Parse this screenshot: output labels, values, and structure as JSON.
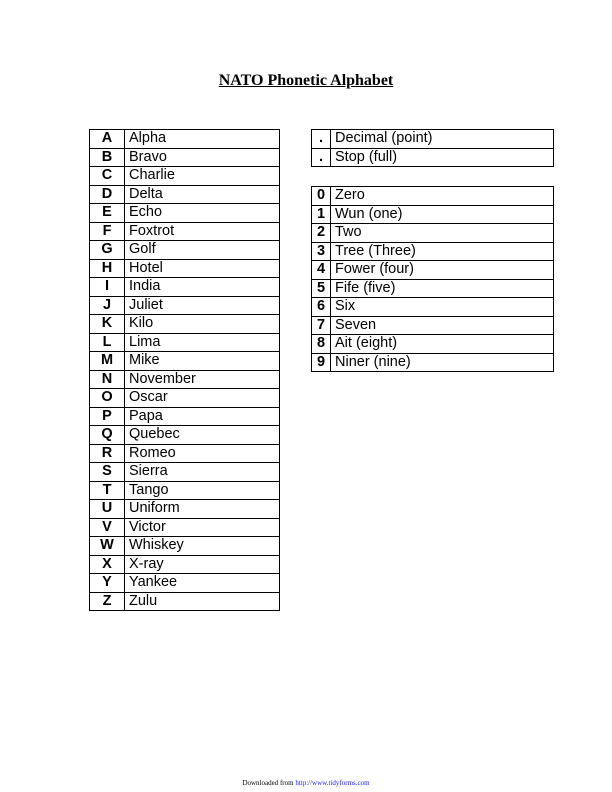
{
  "title": "NATO Phonetic Alphabet",
  "letters": [
    {
      "key": "A",
      "word": "Alpha"
    },
    {
      "key": "B",
      "word": "Bravo"
    },
    {
      "key": "C",
      "word": "Charlie"
    },
    {
      "key": "D",
      "word": "Delta"
    },
    {
      "key": "E",
      "word": "Echo"
    },
    {
      "key": "F",
      "word": "Foxtrot"
    },
    {
      "key": "G",
      "word": "Golf"
    },
    {
      "key": "H",
      "word": "Hotel"
    },
    {
      "key": "I",
      "word": "India"
    },
    {
      "key": "J",
      "word": "Juliet"
    },
    {
      "key": "K",
      "word": "Kilo"
    },
    {
      "key": "L",
      "word": "Lima"
    },
    {
      "key": "M",
      "word": "Mike"
    },
    {
      "key": "N",
      "word": "November"
    },
    {
      "key": "O",
      "word": "Oscar"
    },
    {
      "key": "P",
      "word": "Papa"
    },
    {
      "key": "Q",
      "word": "Quebec"
    },
    {
      "key": "R",
      "word": "Romeo"
    },
    {
      "key": "S",
      "word": "Sierra"
    },
    {
      "key": "T",
      "word": "Tango"
    },
    {
      "key": "U",
      "word": "Uniform"
    },
    {
      "key": "V",
      "word": "Victor"
    },
    {
      "key": "W",
      "word": "Whiskey"
    },
    {
      "key": "X",
      "word": "X-ray"
    },
    {
      "key": "Y",
      "word": "Yankee"
    },
    {
      "key": "Z",
      "word": "Zulu"
    }
  ],
  "symbols": [
    {
      "key": ".",
      "word": "Decimal (point)"
    },
    {
      "key": ".",
      "word": "Stop (full)"
    }
  ],
  "digits": [
    {
      "key": "0",
      "word": "Zero"
    },
    {
      "key": "1",
      "word": "Wun (one)"
    },
    {
      "key": "2",
      "word": "Two"
    },
    {
      "key": "3",
      "word": "Tree (Three)"
    },
    {
      "key": "4",
      "word": "Fower (four)"
    },
    {
      "key": "5",
      "word": "Fife (five)"
    },
    {
      "key": "6",
      "word": "Six"
    },
    {
      "key": "7",
      "word": "Seven"
    },
    {
      "key": "8",
      "word": "Ait (eight)"
    },
    {
      "key": "9",
      "word": "Niner (nine)"
    }
  ],
  "footer": {
    "prefix": "Downloaded from ",
    "link": "http://www.tidyforms.com"
  }
}
